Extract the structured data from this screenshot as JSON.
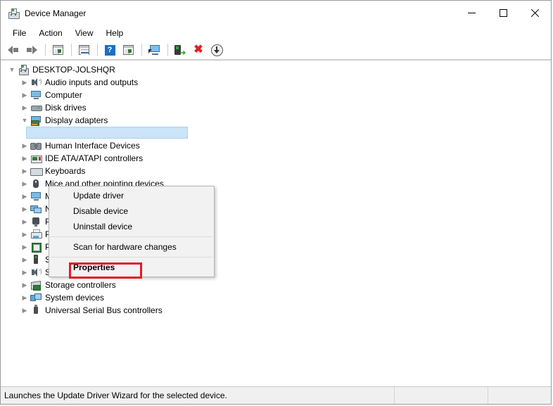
{
  "window": {
    "title": "Device Manager",
    "title_icon": "device-manager-icon",
    "controls": {
      "minimize": "minimize-icon",
      "maximize": "maximize-icon",
      "close": "close-icon"
    }
  },
  "menubar": {
    "items": [
      {
        "label": "File"
      },
      {
        "label": "Action"
      },
      {
        "label": "View"
      },
      {
        "label": "Help"
      }
    ]
  },
  "toolbar": {
    "buttons": [
      {
        "name": "back-icon",
        "tip": "Back"
      },
      {
        "name": "forward-icon",
        "tip": "Forward"
      },
      {
        "name": "show-hide-console-tree-icon",
        "tip": "Show/Hide Console Tree"
      },
      {
        "name": "properties-icon",
        "tip": "Properties"
      },
      {
        "name": "help-icon",
        "tip": "Help"
      },
      {
        "name": "view-devices-icon",
        "tip": "View"
      },
      {
        "name": "scan-for-hardware-changes-icon",
        "tip": "Scan for hardware changes"
      },
      {
        "name": "update-driver-icon",
        "tip": "Update driver"
      },
      {
        "name": "uninstall-device-icon",
        "tip": "Uninstall device"
      },
      {
        "name": "disable-device-icon",
        "tip": "Disable device"
      }
    ]
  },
  "tree": {
    "root": {
      "label": "DESKTOP-JOLSHQR",
      "icon": "computer-root-icon",
      "expanded": true
    },
    "items": [
      {
        "label": "Audio inputs and outputs",
        "icon": "speaker-icon",
        "expanded": false
      },
      {
        "label": "Computer",
        "icon": "monitor-icon",
        "expanded": false
      },
      {
        "label": "Disk drives",
        "icon": "disk-icon",
        "expanded": false
      },
      {
        "label": "Display adapters",
        "icon": "display-adapter-icon",
        "expanded": true
      },
      {
        "label": "",
        "icon": "display-device-icon",
        "expanded": false,
        "selected": true,
        "child": true
      },
      {
        "label": "Human Interface Devices",
        "icon": "hid-icon",
        "expanded": false
      },
      {
        "label": "IDE ATA/ATAPI controllers",
        "icon": "ide-controller-icon",
        "expanded": false
      },
      {
        "label": "Keyboards",
        "icon": "keyboard-icon",
        "expanded": false
      },
      {
        "label": "Mice and other pointing devices",
        "icon": "mouse-icon",
        "expanded": false
      },
      {
        "label": "Monitors",
        "icon": "monitor-icon",
        "expanded": false
      },
      {
        "label": "Network adapters",
        "icon": "network-adapter-icon",
        "expanded": false
      },
      {
        "label": "Ports (COM & LPT)",
        "icon": "port-icon",
        "expanded": false
      },
      {
        "label": "Print queues",
        "icon": "printer-icon",
        "expanded": false
      },
      {
        "label": "Processors",
        "icon": "processor-icon",
        "expanded": false
      },
      {
        "label": "Software devices",
        "icon": "software-device-icon",
        "expanded": false
      },
      {
        "label": "Sound, video and game controllers",
        "icon": "speaker-icon",
        "expanded": false
      },
      {
        "label": "Storage controllers",
        "icon": "storage-controller-icon",
        "expanded": false
      },
      {
        "label": "System devices",
        "icon": "system-device-icon",
        "expanded": false
      },
      {
        "label": "Universal Serial Bus controllers",
        "icon": "usb-icon",
        "expanded": false
      }
    ]
  },
  "context_menu": {
    "items": [
      {
        "label": "Update driver",
        "bold": false
      },
      {
        "label": "Disable device",
        "bold": false
      },
      {
        "label": "Uninstall device",
        "bold": false
      },
      {
        "separator": true
      },
      {
        "label": "Scan for hardware changes",
        "bold": false
      },
      {
        "separator": true
      },
      {
        "label": "Properties",
        "bold": true,
        "highlighted": true
      }
    ],
    "highlight_color": "#e31b23"
  },
  "statusbar": {
    "message": "Launches the Update Driver Wizard for the selected device.",
    "pane2": "",
    "pane3": ""
  }
}
